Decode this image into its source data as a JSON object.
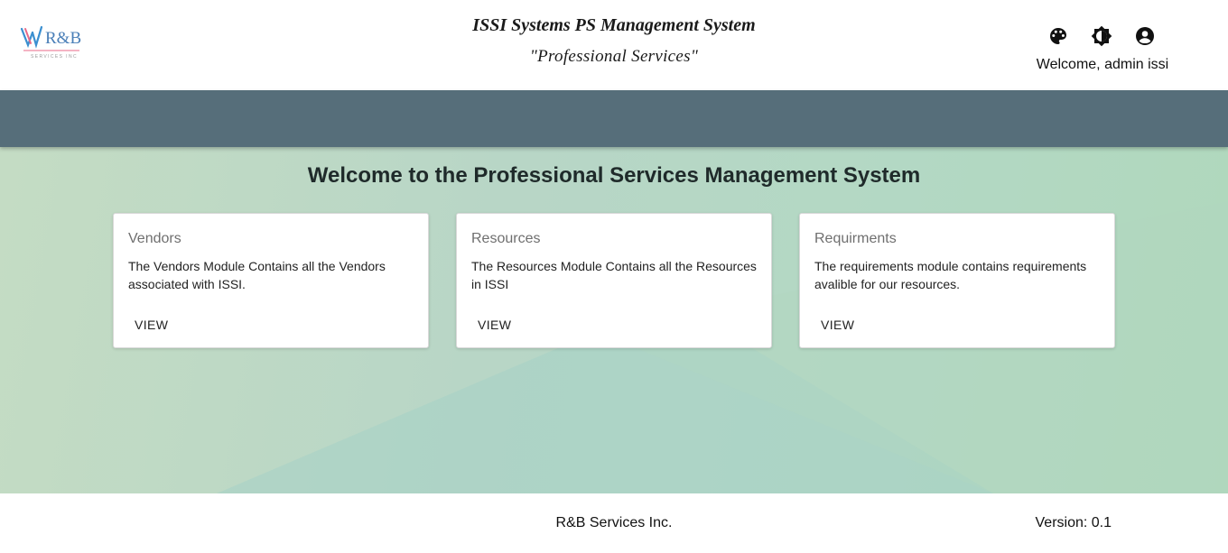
{
  "header": {
    "logo_text": "R&B",
    "logo_subtext": "SERVICES INC",
    "app_title": "ISSI Systems PS Management System",
    "app_subtitle": "\"Professional Services\"",
    "icons": [
      "palette-icon",
      "brightness-icon",
      "account-icon"
    ],
    "welcome_user": "Welcome, admin issi"
  },
  "main": {
    "heading": "Welcome to the Professional Services Management System",
    "cards": [
      {
        "title": "Vendors",
        "description": "The Vendors Module Contains all the Vendors associated with ISSI.",
        "button_label": "VIEW"
      },
      {
        "title": "Resources",
        "description": "The Resources Module Contains all the Resources in ISSI",
        "button_label": "VIEW"
      },
      {
        "title": "Requirments",
        "description": "The requirements module contains requirements avalible for our resources.",
        "button_label": "VIEW"
      }
    ]
  },
  "footer": {
    "company": "R&B Services Inc.",
    "version": "Version: 0.1"
  },
  "colors": {
    "toolbar": "#566e7a",
    "logo_blue": "#3a8fd0",
    "logo_pink": "#e86a88"
  }
}
